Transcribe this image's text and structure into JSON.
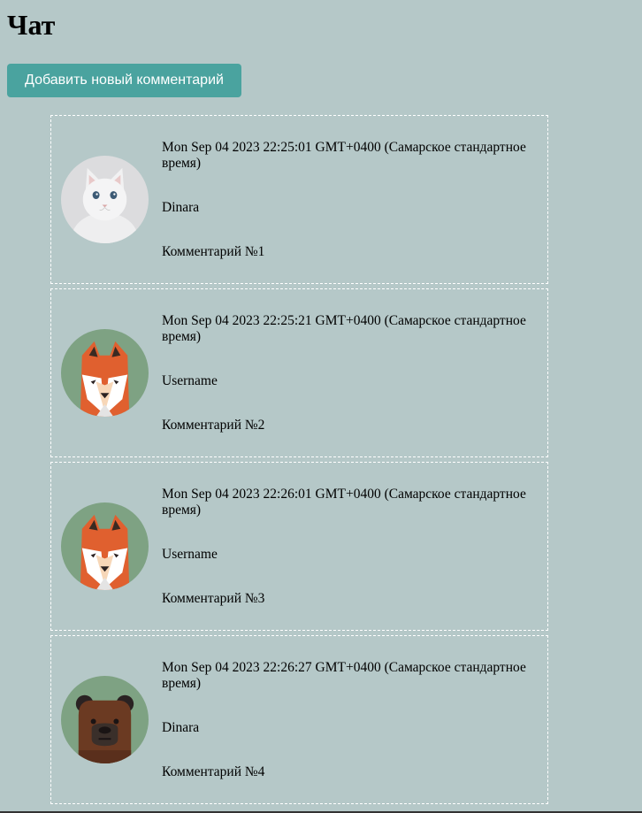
{
  "page": {
    "title": "Чат",
    "add_button_label": "Добавить новый комментарий"
  },
  "colors": {
    "background": "#b5c8c8",
    "button": "#4aa39f",
    "border": "#ffffff"
  },
  "comments": [
    {
      "date": "Mon Sep 04 2023 22:25:01 GMT+0400 (Самарское стандартное время)",
      "username": "Dinara",
      "text": "Комментарий №1",
      "avatar": "white-cat-avatar"
    },
    {
      "date": "Mon Sep 04 2023 22:25:21 GMT+0400 (Самарское стандартное время)",
      "username": "Username",
      "text": "Комментарий №2",
      "avatar": "fox-avatar"
    },
    {
      "date": "Mon Sep 04 2023 22:26:01 GMT+0400 (Самарское стандартное время)",
      "username": "Username",
      "text": "Комментарий №3",
      "avatar": "fox-avatar"
    },
    {
      "date": "Mon Sep 04 2023 22:26:27 GMT+0400 (Самарское стандартное время)",
      "username": "Dinara",
      "text": "Комментарий №4",
      "avatar": "bear-avatar"
    }
  ]
}
